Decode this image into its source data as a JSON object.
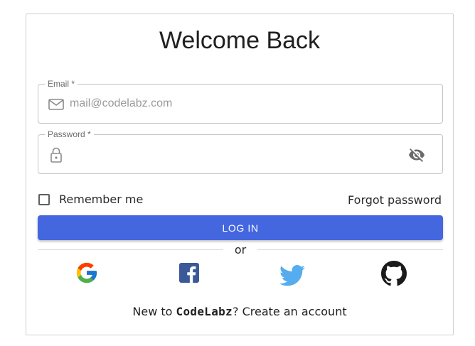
{
  "login": {
    "title": "Welcome Back",
    "email": {
      "label": "Email *",
      "placeholder": "mail@codelabz.com",
      "value": ""
    },
    "password": {
      "label": "Password *",
      "value": ""
    },
    "remember_label": "Remember me",
    "remember_checked": false,
    "forgot_label": "Forgot password",
    "login_label": "LOG IN",
    "divider_text": "or",
    "social": [
      {
        "name": "Google",
        "icon": "google-icon"
      },
      {
        "name": "Facebook",
        "icon": "facebook-icon"
      },
      {
        "name": "Twitter",
        "icon": "twitter-icon"
      },
      {
        "name": "GitHub",
        "icon": "github-icon"
      }
    ],
    "signup": {
      "prefix": "New to ",
      "brand": "CodeLabz",
      "suffix": "? ",
      "link": "Create an account"
    }
  },
  "colors": {
    "primary": "#4467e0",
    "facebook": "#3b5998",
    "twitter": "#55acee",
    "github": "#1b1b1b",
    "border": "#c4c4c4"
  }
}
